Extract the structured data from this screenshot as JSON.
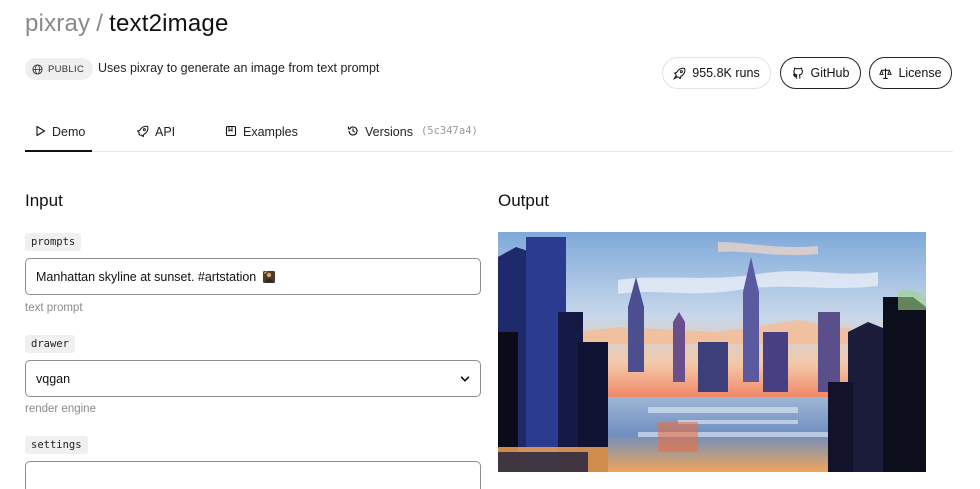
{
  "header": {
    "owner": "pixray",
    "separator": "/",
    "model": "text2image",
    "visibility": "PUBLIC",
    "description": "Uses pixray to generate an image from text prompt"
  },
  "actions": {
    "runs": "955.8K runs",
    "github": "GitHub",
    "license": "License"
  },
  "tabs": [
    {
      "label": "Demo",
      "icon": "play-icon",
      "active": true
    },
    {
      "label": "API",
      "icon": "rocket-icon"
    },
    {
      "label": "Examples",
      "icon": "bookmark-icon"
    },
    {
      "label": "Versions",
      "icon": "history-icon",
      "hash": "(5c347a4)"
    }
  ],
  "input": {
    "heading": "Input",
    "fields": [
      {
        "name": "prompts",
        "value": "Manhattan skyline at sunset. #artstation",
        "hint": "text prompt"
      },
      {
        "name": "drawer",
        "value": "vqgan",
        "hint": "render engine"
      },
      {
        "name": "settings",
        "value": ""
      }
    ]
  },
  "output": {
    "heading": "Output"
  },
  "colors": {
    "accent": "#111111",
    "muted": "#8a8a8a",
    "badge_bg": "#efefef"
  }
}
